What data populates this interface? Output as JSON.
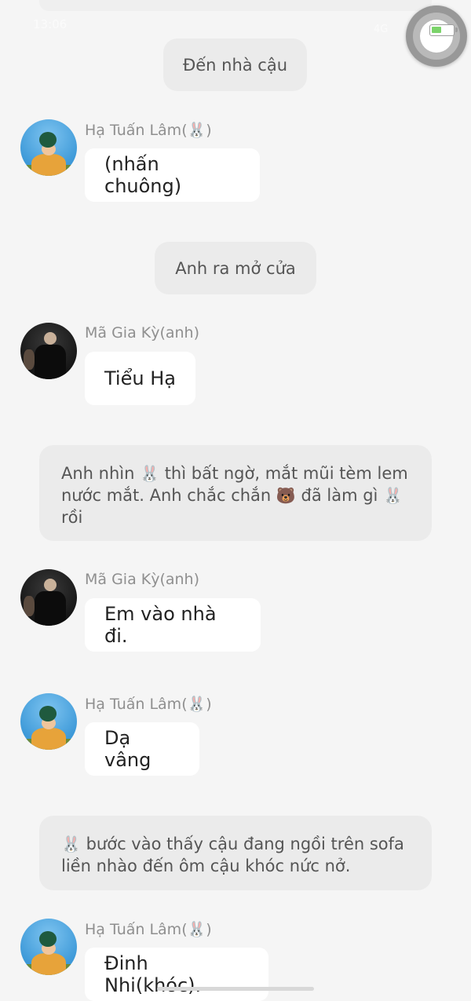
{
  "status_bar": {
    "time": "13:06",
    "signal": "4G"
  },
  "emoji": {
    "bunny": "🐰",
    "bear": "🐻"
  },
  "narrations": [
    {
      "text": "Đến nhà cậu"
    },
    {
      "text": "Anh ra mở cửa"
    },
    {
      "parts": [
        "Anh nhìn ",
        " thì bất ngờ, mắt mũi tèm lem",
        "nước mắt. Anh chắc chắn ",
        " đã làm gì ",
        "rồi"
      ]
    },
    {
      "parts": [
        " bước vào thấy cậu đang ngồi trên sofa",
        "liền nhào đến ôm cậu khóc nức nở."
      ]
    }
  ],
  "senders": {
    "lam": {
      "name_prefix": "Hạ Tuấn Lâm(",
      "name_suffix": ")"
    },
    "ky": {
      "name": "Mã Gia Kỳ(anh)"
    }
  },
  "messages": [
    {
      "text": "(nhấn chuông)"
    },
    {
      "text": "Tiểu Hạ"
    },
    {
      "text": "Em vào nhà đi."
    },
    {
      "text": "Dạ vâng"
    },
    {
      "text": "Đinh Nhi(khóc)."
    }
  ]
}
